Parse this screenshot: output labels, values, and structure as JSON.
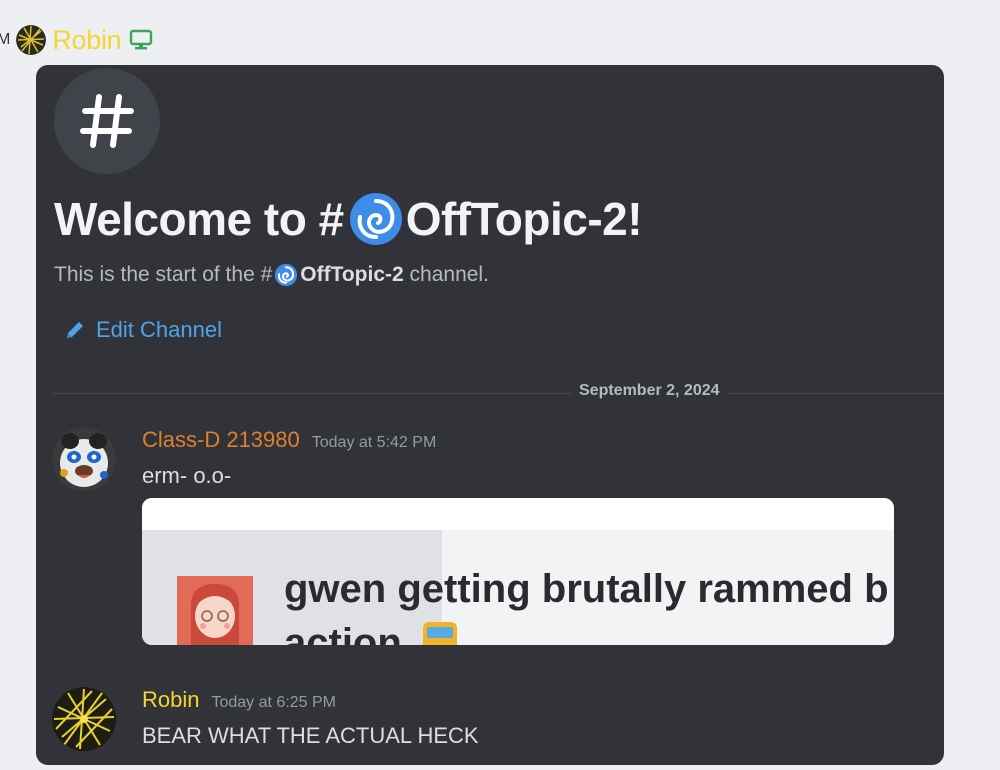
{
  "header": {
    "partial_text": "M",
    "username": "Robin",
    "desktop_icon": "desktop-icon"
  },
  "channel": {
    "icon": "hash-icon",
    "welcome_prefix": "Welcome to #",
    "welcome_name": "OffTopic-2!",
    "start_prefix": "This is the start of the #",
    "start_channel": "OffTopic-2",
    "start_suffix": " channel.",
    "edit_label": "Edit Channel"
  },
  "date_divider": "September 2, 2024",
  "messages": [
    {
      "author": "Class-D 213980",
      "timestamp": "Today at 5:42 PM",
      "content": "erm- o.o-",
      "embed": {
        "title_line1": "gwen getting brutally rammed b",
        "title_line2": "action"
      }
    },
    {
      "author": "Robin",
      "timestamp": "Today at 6:25 PM",
      "content": "BEAR WHAT THE ACTUAL HECK"
    }
  ],
  "colors": {
    "panel_bg": "#313338",
    "link_blue": "#4ea4e6",
    "author_orange": "#e07f2e",
    "author_yellow": "#f3d631",
    "page_bg": "#eeeff2"
  }
}
